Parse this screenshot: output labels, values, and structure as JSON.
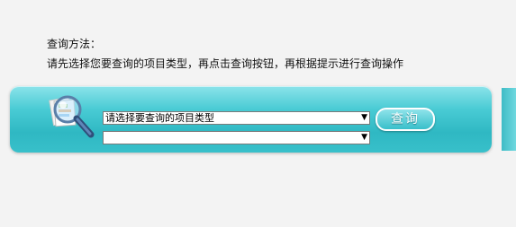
{
  "intro": {
    "title": "查询方法：",
    "instructions": "请先选择您要查询的项目类型，再点击查询按钮，再根据提示进行查询操作"
  },
  "form": {
    "type_select": {
      "selected": "请选择要查询的项目类型"
    },
    "sub_select": {
      "selected": ""
    },
    "search_button": "查询"
  },
  "icons": {
    "search": "magnifier-icon"
  },
  "colors": {
    "panel": "#49cbd4",
    "button": "#38bfca"
  }
}
